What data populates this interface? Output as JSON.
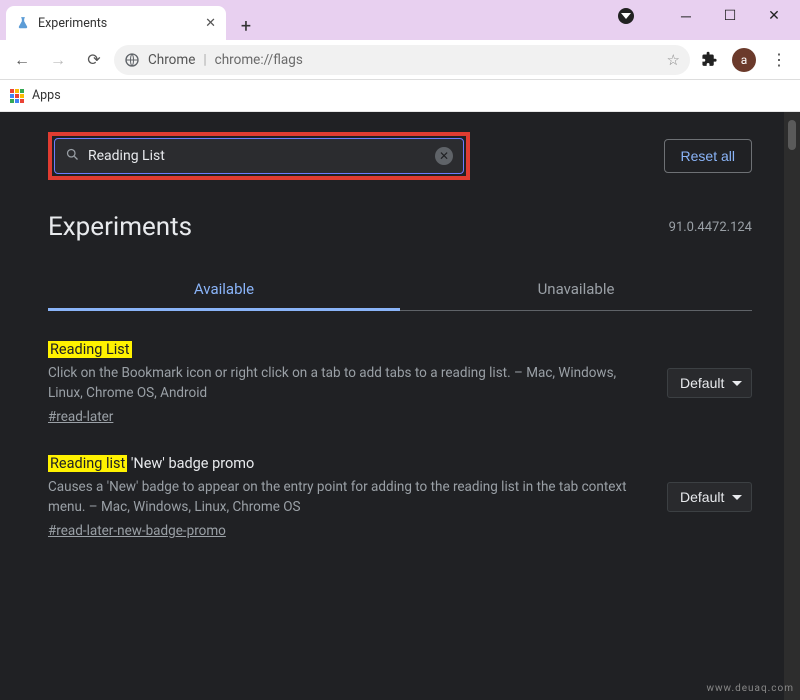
{
  "window": {
    "tab_title": "Experiments"
  },
  "toolbar": {
    "address_prefix": "Chrome",
    "address_url": "chrome://flags",
    "avatar_letter": "a"
  },
  "bookmarks": {
    "apps_label": "Apps"
  },
  "page": {
    "search_value": "Reading List",
    "reset_label": "Reset all",
    "title": "Experiments",
    "version": "91.0.4472.124",
    "tabs": {
      "available": "Available",
      "unavailable": "Unavailable"
    }
  },
  "flags": [
    {
      "title_hl": "Reading List",
      "title_rest": "",
      "desc": "Click on the Bookmark icon or right click on a tab to add tabs to a reading list. – Mac, Windows, Linux, Chrome OS, Android",
      "anchor": "#read-later",
      "dropdown": "Default"
    },
    {
      "title_hl": "Reading list",
      "title_rest": " 'New' badge promo",
      "desc": "Causes a 'New' badge to appear on the entry point for adding to the reading list in the tab context menu. – Mac, Windows, Linux, Chrome OS",
      "anchor": "#read-later-new-badge-promo",
      "dropdown": "Default"
    }
  ],
  "watermark": "www.deuaq.com"
}
